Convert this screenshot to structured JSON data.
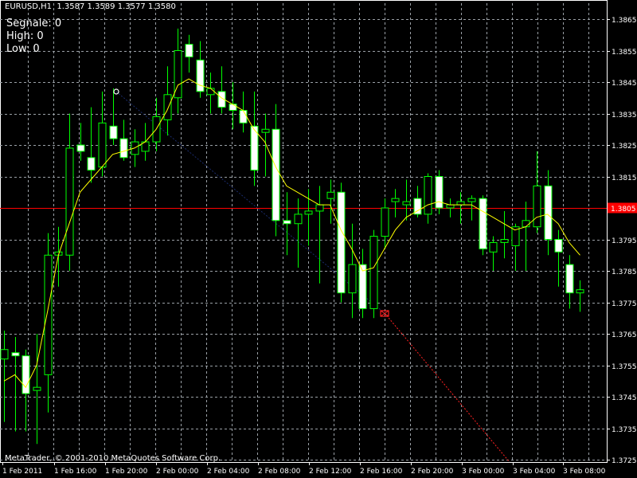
{
  "header": "EURUSD,H1  1.3587 1.3589 1.3577 1.3580",
  "info": {
    "segnale": "Segnale: 0",
    "high": "High: 0",
    "low": "Low: 0"
  },
  "footer": "MetaTrader, © 2001-2010 MetaQuotes Software Corp.",
  "colors": {
    "background": "#000000",
    "grid": "#9aa0a6",
    "bull_body": "#000000",
    "bull_outline": "#00ff00",
    "bear_body": "#ffffff",
    "bear_outline": "#00ff00",
    "wick": "#00ff00",
    "ma": "#ffff00",
    "hline": "#ff0000",
    "price_tag": "#ff0000",
    "axis_text": "#ffffff",
    "trend_dark": "#1a2b6b",
    "trend_red": "#ff2020"
  },
  "chart_data": {
    "type": "candlestick",
    "symbol": "EURUSD",
    "timeframe": "H1",
    "ylim": [
      1.372,
      1.387
    ],
    "y_ticks": [
      "1.3865",
      "1.3855",
      "1.3845",
      "1.3835",
      "1.3825",
      "1.3815",
      "1.3805",
      "1.3795",
      "1.3785",
      "1.3775",
      "1.3765",
      "1.3755",
      "1.3745",
      "1.3735",
      "1.3725"
    ],
    "x_ticks": [
      "1 Feb 2011",
      "1 Feb 16:00",
      "1 Feb 20:00",
      "2 Feb 00:00",
      "2 Feb 04:00",
      "2 Feb 08:00",
      "2 Feb 12:00",
      "2 Feb 16:00",
      "2 Feb 20:00",
      "3 Feb 00:00",
      "3 Feb 04:00",
      "3 Feb 08:00"
    ],
    "current_price": "1.3805",
    "hline_price": 1.3805,
    "candles": [
      {
        "o": 1.3757,
        "h": 1.3766,
        "l": 1.3737,
        "c": 1.376
      },
      {
        "o": 1.3759,
        "h": 1.3764,
        "l": 1.3734,
        "c": 1.3758
      },
      {
        "o": 1.3758,
        "h": 1.376,
        "l": 1.3734,
        "c": 1.3746
      },
      {
        "o": 1.3747,
        "h": 1.3765,
        "l": 1.373,
        "c": 1.3748
      },
      {
        "o": 1.3752,
        "h": 1.3797,
        "l": 1.374,
        "c": 1.379
      },
      {
        "o": 1.379,
        "h": 1.3799,
        "l": 1.378,
        "c": 1.3791
      },
      {
        "o": 1.379,
        "h": 1.3835,
        "l": 1.3785,
        "c": 1.3824
      },
      {
        "o": 1.3825,
        "h": 1.3832,
        "l": 1.382,
        "c": 1.3823
      },
      {
        "o": 1.3821,
        "h": 1.3837,
        "l": 1.3813,
        "c": 1.3817
      },
      {
        "o": 1.3818,
        "h": 1.3842,
        "l": 1.3815,
        "c": 1.3832
      },
      {
        "o": 1.3831,
        "h": 1.3843,
        "l": 1.3825,
        "c": 1.3827
      },
      {
        "o": 1.3827,
        "h": 1.3833,
        "l": 1.382,
        "c": 1.3821
      },
      {
        "o": 1.3822,
        "h": 1.383,
        "l": 1.3818,
        "c": 1.3826
      },
      {
        "o": 1.3823,
        "h": 1.3832,
        "l": 1.382,
        "c": 1.3826
      },
      {
        "o": 1.3826,
        "h": 1.384,
        "l": 1.3823,
        "c": 1.3834
      },
      {
        "o": 1.3833,
        "h": 1.385,
        "l": 1.3828,
        "c": 1.3841
      },
      {
        "o": 1.384,
        "h": 1.3862,
        "l": 1.3835,
        "c": 1.3855
      },
      {
        "o": 1.3857,
        "h": 1.386,
        "l": 1.3848,
        "c": 1.3853
      },
      {
        "o": 1.3852,
        "h": 1.3858,
        "l": 1.384,
        "c": 1.3842
      },
      {
        "o": 1.3841,
        "h": 1.3848,
        "l": 1.3835,
        "c": 1.3843
      },
      {
        "o": 1.3842,
        "h": 1.385,
        "l": 1.3835,
        "c": 1.3837
      },
      {
        "o": 1.3838,
        "h": 1.3845,
        "l": 1.383,
        "c": 1.3836
      },
      {
        "o": 1.3836,
        "h": 1.3842,
        "l": 1.3829,
        "c": 1.3832
      },
      {
        "o": 1.3831,
        "h": 1.3842,
        "l": 1.3812,
        "c": 1.3817
      },
      {
        "o": 1.3829,
        "h": 1.3835,
        "l": 1.3815,
        "c": 1.383
      },
      {
        "o": 1.383,
        "h": 1.3838,
        "l": 1.3796,
        "c": 1.3801
      },
      {
        "o": 1.3801,
        "h": 1.381,
        "l": 1.379,
        "c": 1.38
      },
      {
        "o": 1.38,
        "h": 1.3808,
        "l": 1.3786,
        "c": 1.3803
      },
      {
        "o": 1.3803,
        "h": 1.3811,
        "l": 1.3793,
        "c": 1.3804
      },
      {
        "o": 1.3804,
        "h": 1.3812,
        "l": 1.3781,
        "c": 1.3806
      },
      {
        "o": 1.3808,
        "h": 1.3814,
        "l": 1.38,
        "c": 1.381
      },
      {
        "o": 1.381,
        "h": 1.3813,
        "l": 1.3775,
        "c": 1.3778
      },
      {
        "o": 1.3778,
        "h": 1.38,
        "l": 1.377,
        "c": 1.3787
      },
      {
        "o": 1.3787,
        "h": 1.3792,
        "l": 1.377,
        "c": 1.3773
      },
      {
        "o": 1.3773,
        "h": 1.3798,
        "l": 1.377,
        "c": 1.3796
      },
      {
        "o": 1.3796,
        "h": 1.3808,
        "l": 1.3792,
        "c": 1.3805
      },
      {
        "o": 1.3807,
        "h": 1.3811,
        "l": 1.3802,
        "c": 1.3808
      },
      {
        "o": 1.3806,
        "h": 1.3814,
        "l": 1.3801,
        "c": 1.3807
      },
      {
        "o": 1.3808,
        "h": 1.3812,
        "l": 1.3802,
        "c": 1.3803
      },
      {
        "o": 1.3803,
        "h": 1.3816,
        "l": 1.38,
        "c": 1.3815
      },
      {
        "o": 1.3815,
        "h": 1.3817,
        "l": 1.3803,
        "c": 1.3805
      },
      {
        "o": 1.3805,
        "h": 1.3808,
        "l": 1.3802,
        "c": 1.3806
      },
      {
        "o": 1.3806,
        "h": 1.381,
        "l": 1.38,
        "c": 1.3807
      },
      {
        "o": 1.3807,
        "h": 1.3809,
        "l": 1.3801,
        "c": 1.3808
      },
      {
        "o": 1.3808,
        "h": 1.3809,
        "l": 1.379,
        "c": 1.3792
      },
      {
        "o": 1.3791,
        "h": 1.3796,
        "l": 1.3785,
        "c": 1.3794
      },
      {
        "o": 1.3794,
        "h": 1.3804,
        "l": 1.3789,
        "c": 1.3795
      },
      {
        "o": 1.3793,
        "h": 1.38,
        "l": 1.3785,
        "c": 1.3799
      },
      {
        "o": 1.3799,
        "h": 1.3807,
        "l": 1.3785,
        "c": 1.3801
      },
      {
        "o": 1.3799,
        "h": 1.3823,
        "l": 1.3797,
        "c": 1.3812
      },
      {
        "o": 1.3812,
        "h": 1.3817,
        "l": 1.379,
        "c": 1.3795
      },
      {
        "o": 1.3795,
        "h": 1.3798,
        "l": 1.378,
        "c": 1.3791
      },
      {
        "o": 1.3787,
        "h": 1.379,
        "l": 1.3773,
        "c": 1.3778
      },
      {
        "o": 1.3778,
        "h": 1.3782,
        "l": 1.3772,
        "c": 1.3779
      }
    ],
    "ma_values": [
      1.375,
      1.3752,
      1.3748,
      1.3755,
      1.3772,
      1.379,
      1.38,
      1.381,
      1.3814,
      1.3818,
      1.3822,
      1.3823,
      1.3824,
      1.3826,
      1.383,
      1.3836,
      1.3844,
      1.3846,
      1.3844,
      1.3843,
      1.384,
      1.3838,
      1.3836,
      1.383,
      1.3826,
      1.3818,
      1.3812,
      1.381,
      1.3808,
      1.3806,
      1.3806,
      1.3798,
      1.3792,
      1.3785,
      1.3786,
      1.3792,
      1.3798,
      1.3802,
      1.3804,
      1.3806,
      1.3807,
      1.3806,
      1.3806,
      1.3806,
      1.3804,
      1.3802,
      1.38,
      1.3798,
      1.3799,
      1.3802,
      1.3803,
      1.38,
      1.3794,
      1.379
    ]
  }
}
